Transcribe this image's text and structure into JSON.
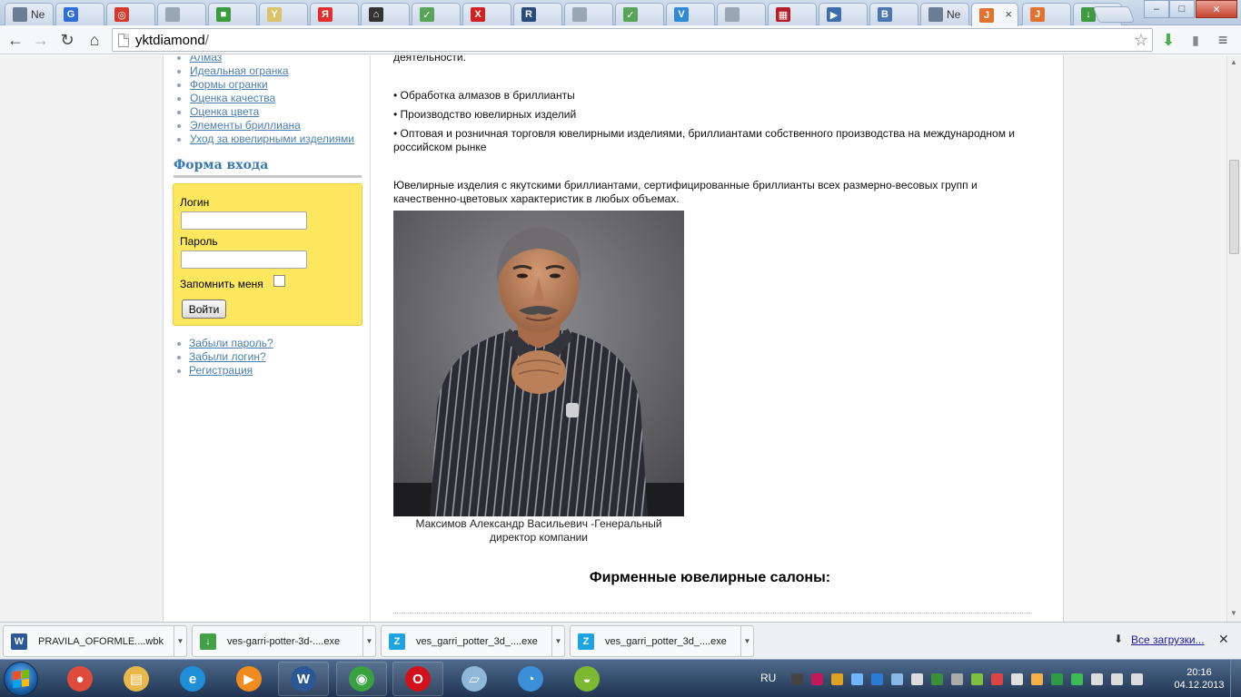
{
  "browser": {
    "tabs": [
      {
        "label": "Ne",
        "icon": "generic-page-icon",
        "color": "#6b7d93"
      },
      {
        "label": "",
        "icon": "blue-circle-icon",
        "color": "#2f6fd3"
      },
      {
        "label": "",
        "icon": "target-icon",
        "color": "#d33a2c"
      },
      {
        "label": "",
        "icon": "generic-page-icon",
        "color": "#9aa6b4"
      },
      {
        "label": "",
        "icon": "windows-tiles-icon",
        "color": "#3c9b3c"
      },
      {
        "label": "",
        "icon": "cup-icon",
        "color": "#d8c36a"
      },
      {
        "label": "",
        "icon": "yandex-icon",
        "color": "#e0302b"
      },
      {
        "label": "",
        "icon": "graduation-cap-icon",
        "color": "#333333"
      },
      {
        "label": "",
        "icon": "ticket-icon",
        "color": "#5aa35a"
      },
      {
        "label": "",
        "icon": "red-x-icon",
        "color": "#d22121"
      },
      {
        "label": "",
        "icon": "r-letter-icon",
        "color": "#2a4b7c"
      },
      {
        "label": "",
        "icon": "generic-page-icon",
        "color": "#9aa6b4"
      },
      {
        "label": "",
        "icon": "ticket-icon",
        "color": "#5aa35a"
      },
      {
        "label": "",
        "icon": "v-circle-icon",
        "color": "#2f8ad3"
      },
      {
        "label": "",
        "icon": "generic-page-icon",
        "color": "#9aa6b4"
      },
      {
        "label": "",
        "icon": "red-grid-icon",
        "color": "#b41e2b"
      },
      {
        "label": "",
        "icon": "play-icon",
        "color": "#3b6ea8"
      },
      {
        "label": "",
        "icon": "b-letter-icon",
        "color": "#4a77b0"
      },
      {
        "label": "Ne",
        "icon": "generic-page-icon",
        "color": "#6b7d93"
      },
      {
        "label": "",
        "icon": "joomla-icon",
        "color": "#e2722f",
        "active": true
      },
      {
        "label": "",
        "icon": "joomla-icon",
        "color": "#e2722f"
      },
      {
        "label": "",
        "icon": "green-arrow-icon",
        "color": "#3f9a3f"
      }
    ],
    "tab_glyphs": [
      "",
      "G",
      "◎",
      "",
      "■",
      "Y",
      "Я",
      "⌂",
      "✓",
      "X",
      "R",
      "",
      "✓",
      "V",
      "",
      "▦",
      "▶",
      "B",
      "",
      "J",
      "J",
      "↓"
    ],
    "active_tab_close": "×",
    "window_controls": {
      "minimize": "–",
      "maximize": "□",
      "close": "✕"
    },
    "url_host": "yktdiamond",
    "url_path": "/"
  },
  "sidebar": {
    "menu": [
      "Алмаз",
      "Идеальная огранка",
      "Формы огранки",
      "Оценка качества",
      "Оценка цвета",
      "Элементы бриллиана",
      "Уход за ювелирными изделиями"
    ],
    "login_form": {
      "heading": "Форма входа",
      "login_label": "Логин",
      "login_value": "",
      "password_label": "Пароль",
      "password_value": "",
      "remember_label": "Запомнить меня",
      "remember_checked": false,
      "submit_label": "Войти"
    },
    "links": [
      "Забыли пароль?",
      "Забыли логин?",
      "Регистрация"
    ]
  },
  "content": {
    "top_fragment": "деятельности.",
    "activities": [
      "• Обработка алмазов в бриллианты",
      "• Производство ювелирных изделий",
      "• Оптовая и розничная торговля ювелирными изделиями, бриллиантами собственного производства на международном и",
      "российском рынке"
    ],
    "description_line1": "Ювелирные изделия с якутскими бриллиантами, сертифицированные бриллианты всех размерно-весовых групп и",
    "description_line2": "качественно-цветовых характеристик в любых объемах.",
    "photo_caption_line1": "Максимов Александр Васильевич -Генеральный",
    "photo_caption_line2": "директор компании",
    "salons_heading": "Фирменные ювелирные салоны:"
  },
  "downloads": {
    "items": [
      {
        "name": "PRAVILA_OFORMLE....wbk",
        "icon": "word-doc-icon",
        "color": "#2b5797",
        "glyph": "W"
      },
      {
        "name": "ves-garri-potter-3d-....exe",
        "icon": "download-arrow-icon",
        "color": "#43a047",
        "glyph": "↓"
      },
      {
        "name": "ves_garri_potter_3d_....exe",
        "icon": "zona-icon",
        "color": "#1fa3e0",
        "glyph": "Z"
      },
      {
        "name": "ves_garri_potter_3d_....exe",
        "icon": "zona-icon",
        "color": "#1fa3e0",
        "glyph": "Z"
      }
    ],
    "all_downloads_label": "Все загрузки...",
    "close": "✕"
  },
  "taskbar": {
    "apps": [
      {
        "name": "media-player-icon",
        "color": "#e04a3a",
        "glyph": "●"
      },
      {
        "name": "file-explorer-icon",
        "color": "#e8b84a",
        "glyph": "▤"
      },
      {
        "name": "internet-explorer-icon",
        "color": "#1f8fd8",
        "glyph": "e"
      },
      {
        "name": "media-center-icon",
        "color": "#f08c1e",
        "glyph": "▶"
      },
      {
        "name": "microsoft-word-icon",
        "color": "#2b5797",
        "glyph": "W"
      },
      {
        "name": "chrome-icon",
        "color": "#3aa142",
        "glyph": "◉"
      },
      {
        "name": "opera-icon",
        "color": "#d1121c",
        "glyph": "O"
      },
      {
        "name": "notepad-icon",
        "color": "#8fb8d8",
        "glyph": "▱"
      },
      {
        "name": "messenger-icon",
        "color": "#3a8fd8",
        "glyph": "◔"
      },
      {
        "name": "colorful-app-icon",
        "color": "#7cb830",
        "glyph": "◒"
      }
    ],
    "language": "RU",
    "time": "20:16",
    "date": "04.12.2013"
  }
}
